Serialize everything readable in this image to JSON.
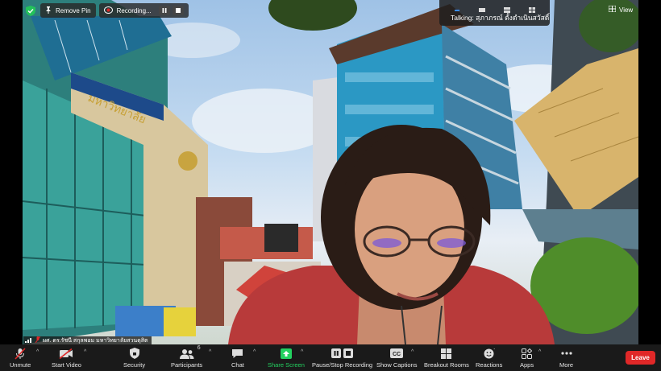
{
  "top_bar": {
    "remove_pin_label": "Remove Pin",
    "recording_label": "Recording...",
    "talking_label": "Talking: สุภาภรณ์ ตั้งดำเนินสวัสดิ์",
    "view_label": "View"
  },
  "video": {
    "participant_name": "ผศ. ดร.รัชนี สกุลพอม มหาวิทยาลัยสวนดุสิต",
    "building_sign": "มหาวิทยาลัย"
  },
  "toolbar": {
    "unmute": "Unmute",
    "start_video": "Start Video",
    "security": "Security",
    "participants": "Participants",
    "participants_count": "6",
    "chat": "Chat",
    "share_screen": "Share Screen",
    "pause_stop_recording": "Pause/Stop Recording",
    "show_captions": "Show Captions",
    "breakout_rooms": "Breakout Rooms",
    "reactions": "Reactions",
    "apps": "Apps",
    "more": "More",
    "leave": "Leave"
  },
  "colors": {
    "toolbar_bg": "#1a1a1a",
    "leave_red": "#e02828",
    "share_green": "#23d160"
  }
}
